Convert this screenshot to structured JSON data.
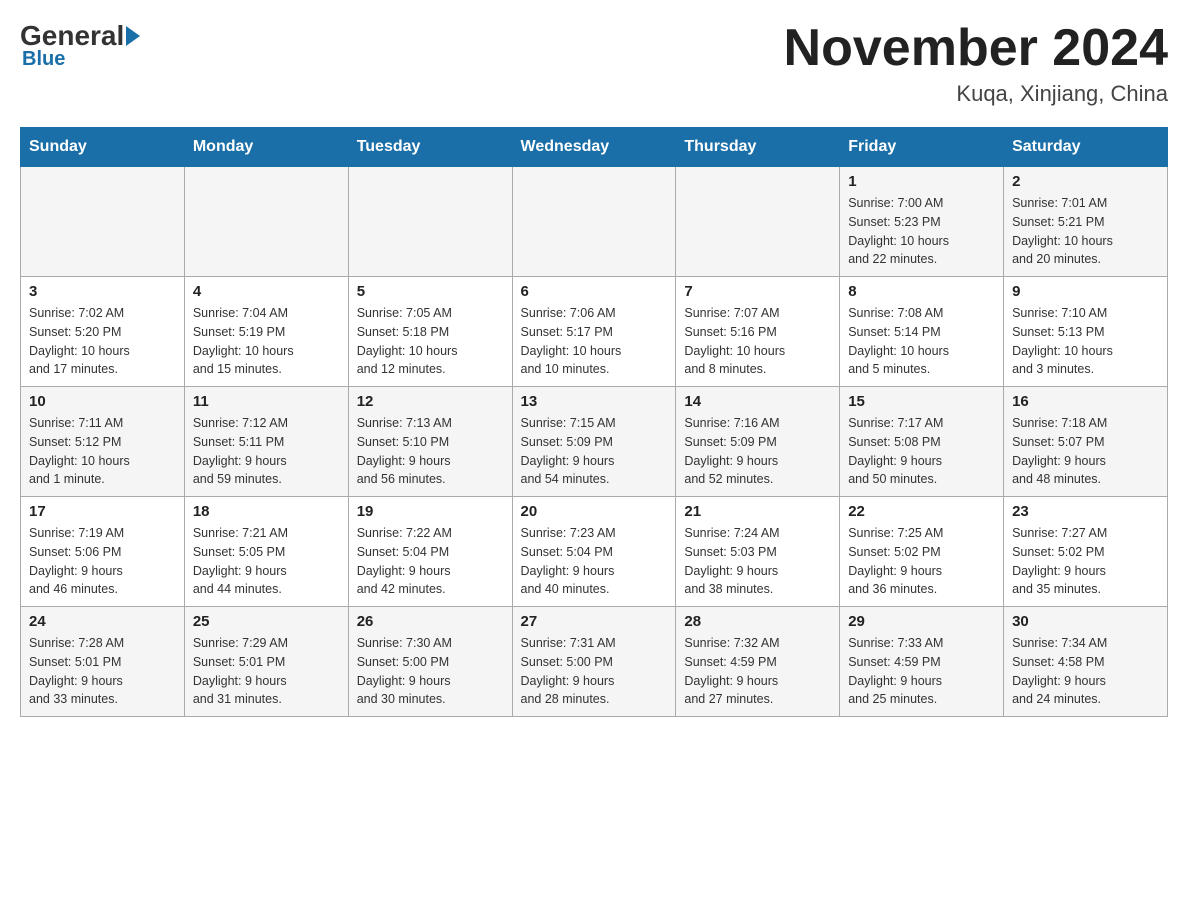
{
  "logo": {
    "general": "General",
    "blue": "Blue",
    "subtext": "Blue"
  },
  "title": "November 2024",
  "subtitle": "Kuqa, Xinjiang, China",
  "weekdays": [
    "Sunday",
    "Monday",
    "Tuesday",
    "Wednesday",
    "Thursday",
    "Friday",
    "Saturday"
  ],
  "weeks": [
    [
      {
        "day": "",
        "info": ""
      },
      {
        "day": "",
        "info": ""
      },
      {
        "day": "",
        "info": ""
      },
      {
        "day": "",
        "info": ""
      },
      {
        "day": "",
        "info": ""
      },
      {
        "day": "1",
        "info": "Sunrise: 7:00 AM\nSunset: 5:23 PM\nDaylight: 10 hours\nand 22 minutes."
      },
      {
        "day": "2",
        "info": "Sunrise: 7:01 AM\nSunset: 5:21 PM\nDaylight: 10 hours\nand 20 minutes."
      }
    ],
    [
      {
        "day": "3",
        "info": "Sunrise: 7:02 AM\nSunset: 5:20 PM\nDaylight: 10 hours\nand 17 minutes."
      },
      {
        "day": "4",
        "info": "Sunrise: 7:04 AM\nSunset: 5:19 PM\nDaylight: 10 hours\nand 15 minutes."
      },
      {
        "day": "5",
        "info": "Sunrise: 7:05 AM\nSunset: 5:18 PM\nDaylight: 10 hours\nand 12 minutes."
      },
      {
        "day": "6",
        "info": "Sunrise: 7:06 AM\nSunset: 5:17 PM\nDaylight: 10 hours\nand 10 minutes."
      },
      {
        "day": "7",
        "info": "Sunrise: 7:07 AM\nSunset: 5:16 PM\nDaylight: 10 hours\nand 8 minutes."
      },
      {
        "day": "8",
        "info": "Sunrise: 7:08 AM\nSunset: 5:14 PM\nDaylight: 10 hours\nand 5 minutes."
      },
      {
        "day": "9",
        "info": "Sunrise: 7:10 AM\nSunset: 5:13 PM\nDaylight: 10 hours\nand 3 minutes."
      }
    ],
    [
      {
        "day": "10",
        "info": "Sunrise: 7:11 AM\nSunset: 5:12 PM\nDaylight: 10 hours\nand 1 minute."
      },
      {
        "day": "11",
        "info": "Sunrise: 7:12 AM\nSunset: 5:11 PM\nDaylight: 9 hours\nand 59 minutes."
      },
      {
        "day": "12",
        "info": "Sunrise: 7:13 AM\nSunset: 5:10 PM\nDaylight: 9 hours\nand 56 minutes."
      },
      {
        "day": "13",
        "info": "Sunrise: 7:15 AM\nSunset: 5:09 PM\nDaylight: 9 hours\nand 54 minutes."
      },
      {
        "day": "14",
        "info": "Sunrise: 7:16 AM\nSunset: 5:09 PM\nDaylight: 9 hours\nand 52 minutes."
      },
      {
        "day": "15",
        "info": "Sunrise: 7:17 AM\nSunset: 5:08 PM\nDaylight: 9 hours\nand 50 minutes."
      },
      {
        "day": "16",
        "info": "Sunrise: 7:18 AM\nSunset: 5:07 PM\nDaylight: 9 hours\nand 48 minutes."
      }
    ],
    [
      {
        "day": "17",
        "info": "Sunrise: 7:19 AM\nSunset: 5:06 PM\nDaylight: 9 hours\nand 46 minutes."
      },
      {
        "day": "18",
        "info": "Sunrise: 7:21 AM\nSunset: 5:05 PM\nDaylight: 9 hours\nand 44 minutes."
      },
      {
        "day": "19",
        "info": "Sunrise: 7:22 AM\nSunset: 5:04 PM\nDaylight: 9 hours\nand 42 minutes."
      },
      {
        "day": "20",
        "info": "Sunrise: 7:23 AM\nSunset: 5:04 PM\nDaylight: 9 hours\nand 40 minutes."
      },
      {
        "day": "21",
        "info": "Sunrise: 7:24 AM\nSunset: 5:03 PM\nDaylight: 9 hours\nand 38 minutes."
      },
      {
        "day": "22",
        "info": "Sunrise: 7:25 AM\nSunset: 5:02 PM\nDaylight: 9 hours\nand 36 minutes."
      },
      {
        "day": "23",
        "info": "Sunrise: 7:27 AM\nSunset: 5:02 PM\nDaylight: 9 hours\nand 35 minutes."
      }
    ],
    [
      {
        "day": "24",
        "info": "Sunrise: 7:28 AM\nSunset: 5:01 PM\nDaylight: 9 hours\nand 33 minutes."
      },
      {
        "day": "25",
        "info": "Sunrise: 7:29 AM\nSunset: 5:01 PM\nDaylight: 9 hours\nand 31 minutes."
      },
      {
        "day": "26",
        "info": "Sunrise: 7:30 AM\nSunset: 5:00 PM\nDaylight: 9 hours\nand 30 minutes."
      },
      {
        "day": "27",
        "info": "Sunrise: 7:31 AM\nSunset: 5:00 PM\nDaylight: 9 hours\nand 28 minutes."
      },
      {
        "day": "28",
        "info": "Sunrise: 7:32 AM\nSunset: 4:59 PM\nDaylight: 9 hours\nand 27 minutes."
      },
      {
        "day": "29",
        "info": "Sunrise: 7:33 AM\nSunset: 4:59 PM\nDaylight: 9 hours\nand 25 minutes."
      },
      {
        "day": "30",
        "info": "Sunrise: 7:34 AM\nSunset: 4:58 PM\nDaylight: 9 hours\nand 24 minutes."
      }
    ]
  ]
}
